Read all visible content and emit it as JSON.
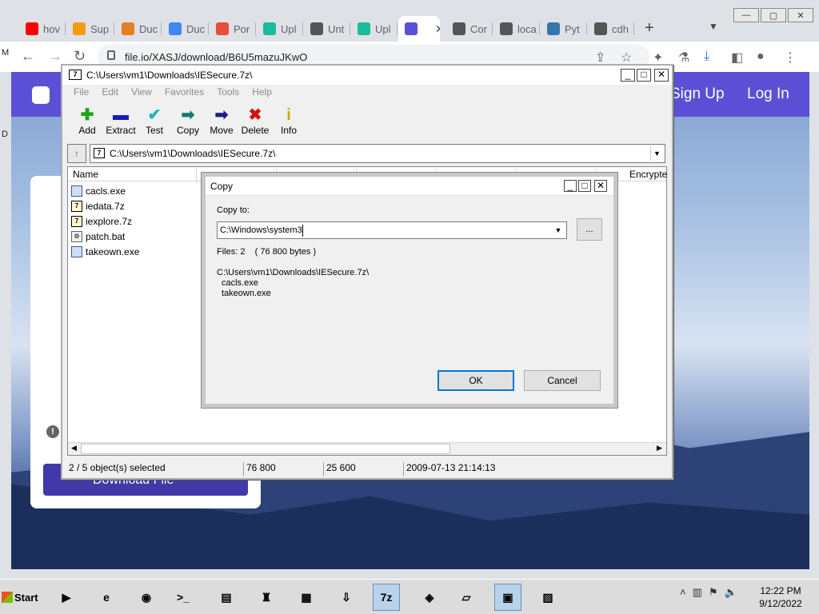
{
  "browser": {
    "tabs": [
      {
        "label": "hov",
        "favicon": "youtube-icon",
        "color": "#ff0000"
      },
      {
        "label": "Sup",
        "favicon": "diamond-icon",
        "color": "#f39c12"
      },
      {
        "label": "Duc",
        "favicon": "power-icon",
        "color": "#e67e22"
      },
      {
        "label": "Duc",
        "favicon": "chrome-icon",
        "color": "#4285f4"
      },
      {
        "label": "Por",
        "favicon": "tag-icon",
        "color": "#e74c3c"
      },
      {
        "label": "Upl",
        "favicon": "upload-icon",
        "color": "#1abc9c"
      },
      {
        "label": "Unt",
        "favicon": "globe-icon",
        "color": "#555555"
      },
      {
        "label": "Upl",
        "favicon": "upload-icon",
        "color": "#1abc9c"
      },
      {
        "label": "",
        "favicon": "fileio-icon",
        "color": "#5b4fd6",
        "active": true
      },
      {
        "label": "Cor",
        "favicon": "globe-icon",
        "color": "#555555"
      },
      {
        "label": "loca",
        "favicon": "globe-icon",
        "color": "#555555"
      },
      {
        "label": "Pyt",
        "favicon": "python-icon",
        "color": "#3776ab"
      },
      {
        "label": "cdh",
        "favicon": "globe-icon",
        "color": "#555555"
      }
    ],
    "url": "file.io/XASJ/download/B6U5mazuJKwO"
  },
  "webpage": {
    "signup": "Sign Up",
    "login": "Log In",
    "download_btn": "Download File",
    "accent": "#5b4fd6",
    "side_letters": {
      "m": "M",
      "d": "D"
    }
  },
  "zip": {
    "title": "C:\\Users\\vm1\\Downloads\\IESecure.7z\\",
    "menu": [
      "File",
      "Edit",
      "View",
      "Favorites",
      "Tools",
      "Help"
    ],
    "tools": [
      {
        "label": "Add",
        "icon": "plus-icon",
        "glyph": "✚",
        "color": "#19a519"
      },
      {
        "label": "Extract",
        "icon": "minus-icon",
        "glyph": "▬",
        "color": "#1b1bb3"
      },
      {
        "label": "Test",
        "icon": "check-icon",
        "glyph": "✔",
        "color": "#18b7b7"
      },
      {
        "label": "Copy",
        "icon": "copy-arrow-icon",
        "glyph": "➡",
        "color": "#167a6e"
      },
      {
        "label": "Move",
        "icon": "move-arrow-icon",
        "glyph": "➡",
        "color": "#1b1b8c"
      },
      {
        "label": "Delete",
        "icon": "delete-x-icon",
        "glyph": "✖",
        "color": "#d11313"
      },
      {
        "label": "Info",
        "icon": "info-icon",
        "glyph": "i",
        "color": "#d4a300"
      }
    ],
    "address": "C:\\Users\\vm1\\Downloads\\IESecure.7z\\",
    "columns": {
      "name": "Name",
      "encrypted": "Encrypte"
    },
    "files": [
      {
        "name": "cacls.exe",
        "type": "exe"
      },
      {
        "name": "iedata.7z",
        "type": "7z"
      },
      {
        "name": "iexplore.7z",
        "type": "7z"
      },
      {
        "name": "patch.bat",
        "type": "bat"
      },
      {
        "name": "takeown.exe",
        "type": "exe"
      }
    ],
    "status": {
      "selected": "2 / 5 object(s) selected",
      "size": "76 800",
      "packed": "25 600",
      "modified": "2009-07-13 21:14:13"
    }
  },
  "copy_dialog": {
    "title": "Copy",
    "copy_to_label": "Copy to:",
    "destination": "C:\\Windows\\system3",
    "files_info": "Files: 2    ( 76 800 bytes )",
    "source_path": "C:\\Users\\vm1\\Downloads\\IESecure.7z\\",
    "items": [
      "cacls.exe",
      "takeown.exe"
    ],
    "browse": "...",
    "ok": "OK",
    "cancel": "Cancel"
  },
  "taskbar": {
    "start": "Start",
    "apps": [
      {
        "icon": "media-player-icon",
        "glyph": "▶"
      },
      {
        "icon": "ie-icon",
        "glyph": "e"
      },
      {
        "icon": "chrome-icon",
        "glyph": "◉"
      },
      {
        "icon": "cmd-icon",
        "glyph": ">_"
      },
      {
        "icon": "explorer-icon",
        "glyph": "▤"
      },
      {
        "icon": "game-icon",
        "glyph": "♜"
      },
      {
        "icon": "network-icon",
        "glyph": "▦"
      },
      {
        "icon": "installer-icon",
        "glyph": "⇩"
      },
      {
        "icon": "7zip-icon",
        "glyph": "7z",
        "pressed": true
      },
      {
        "icon": "python-icon",
        "glyph": "◈"
      },
      {
        "icon": "notepad-icon",
        "glyph": "▱"
      },
      {
        "icon": "remote-icon",
        "glyph": "▣",
        "pressed": true
      },
      {
        "icon": "image-icon",
        "glyph": "▨"
      }
    ],
    "time": "12:22 PM",
    "date": "9/12/2022"
  }
}
